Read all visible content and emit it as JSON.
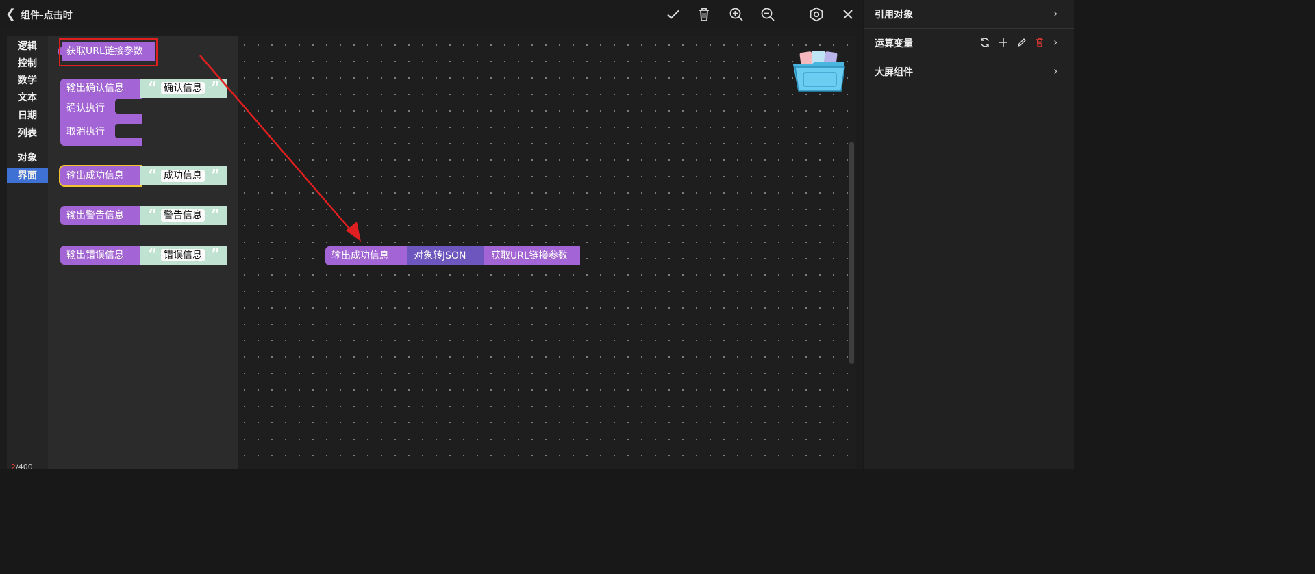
{
  "header": {
    "title": "组件-点击时"
  },
  "toolbar": {
    "icons": [
      "check-icon",
      "trash-icon",
      "zoom-in-icon",
      "zoom-out-icon",
      "settings-icon",
      "close-icon"
    ]
  },
  "categories": [
    "逻辑",
    "控制",
    "数学",
    "文本",
    "日期",
    "列表",
    "对象",
    "界面"
  ],
  "active_category": "界面",
  "counter": {
    "current": "2",
    "total": "/400"
  },
  "flyout": {
    "get_url_param": "获取URL链接参数",
    "confirm": {
      "label": "输出确认信息",
      "text": "确认信息",
      "ok_label": "确认执行",
      "cancel_label": "取消执行"
    },
    "success": {
      "label": "输出成功信息",
      "text": "成功信息"
    },
    "warning": {
      "label": "输出警告信息",
      "text": "警告信息"
    },
    "error": {
      "label": "输出错误信息",
      "text": "错误信息"
    }
  },
  "canvas_chain": {
    "output": "输出成功信息",
    "to_json": "对象转JSON",
    "get_url_param": "获取URL链接参数"
  },
  "right_panel": {
    "ref_objects": "引用对象",
    "variables": "运算变量",
    "screen_components": "大屏组件"
  },
  "colors": {
    "block_purple": "#a365d6",
    "block_indigo": "#6e56bf",
    "text_block": "#bfe3d0",
    "highlight_red": "#e02020",
    "selected_yellow": "#f2c230",
    "active_category": "#3f70d4",
    "delete_red": "#e53935"
  }
}
